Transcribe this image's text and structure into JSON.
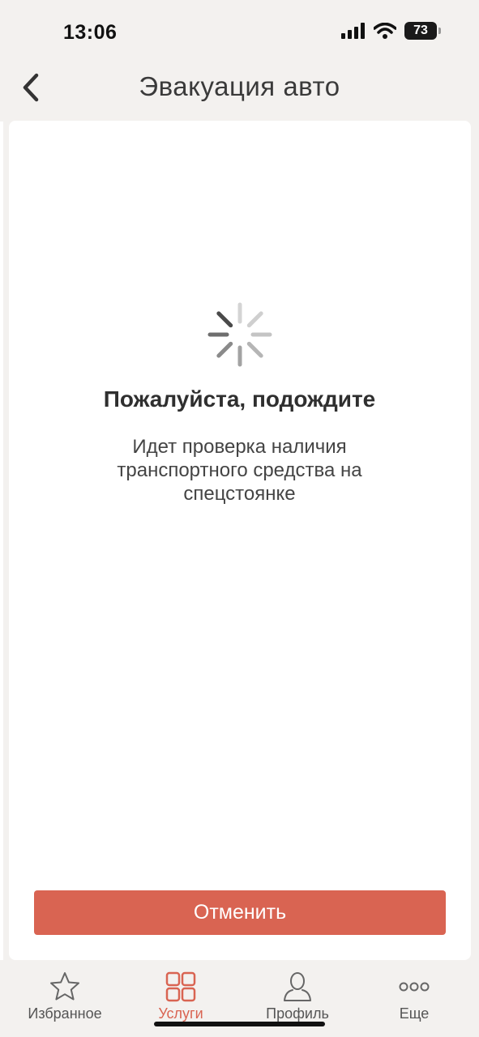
{
  "status_bar": {
    "time": "13:06",
    "battery": "73"
  },
  "header": {
    "title": "Эвакуация авто"
  },
  "loading": {
    "title": "Пожалуйста, подождите",
    "lines": [
      "Идет проверка наличия",
      "транспортного средства на",
      "спецстоянке"
    ]
  },
  "actions": {
    "cancel_label": "Отменить"
  },
  "tab_bar": {
    "items": [
      {
        "label": "Избранное",
        "icon": "star-icon",
        "active": false
      },
      {
        "label": "Услуги",
        "icon": "grid-icon",
        "active": true
      },
      {
        "label": "Профиль",
        "icon": "person-icon",
        "active": false
      },
      {
        "label": "Еще",
        "icon": "more-icon",
        "active": false
      }
    ]
  },
  "colors": {
    "accent": "#d96452",
    "background": "#f3f1ef",
    "card": "#ffffff"
  }
}
